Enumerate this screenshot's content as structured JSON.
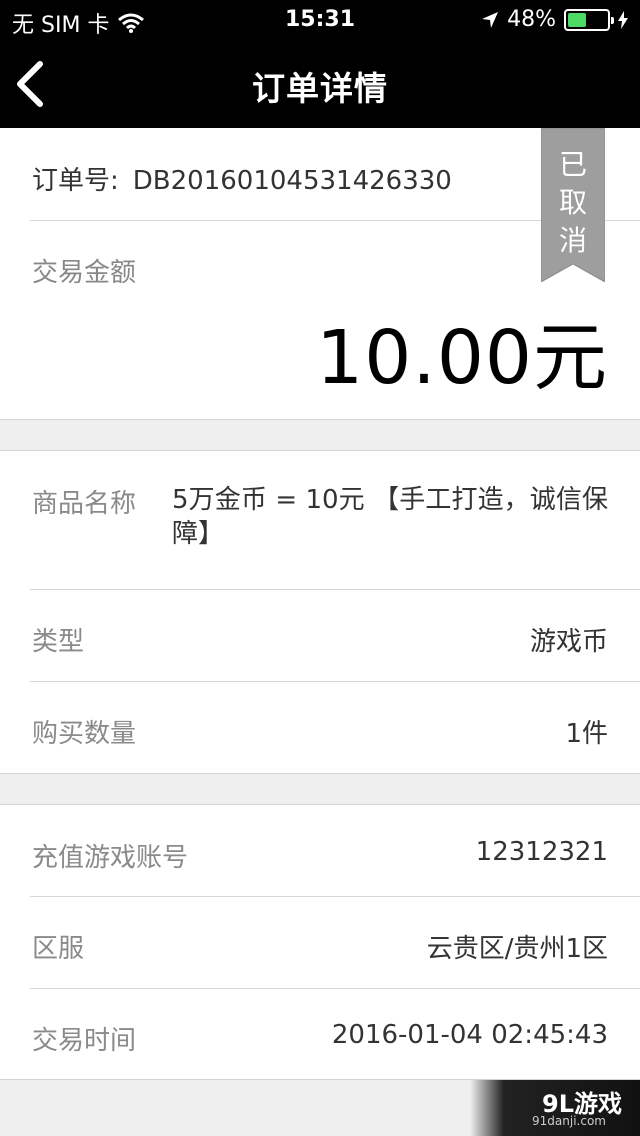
{
  "status_bar": {
    "carrier": "无 SIM 卡",
    "time": "15:31",
    "battery": "48%",
    "battery_level": 0.48
  },
  "nav": {
    "title": "订单详情"
  },
  "order": {
    "number_label": "订单号:",
    "number": "DB20160104531426330",
    "status": "已取消",
    "amount_label": "交易金额",
    "amount": "10.00元"
  },
  "goods": {
    "name_label": "商品名称",
    "name": "5万金币 = 10元 【手工打造，诚信保障】",
    "type_label": "类型",
    "type": "游戏币",
    "qty_label": "购买数量",
    "qty": "1件"
  },
  "account": {
    "account_label": "充值游戏账号",
    "account": "12312321",
    "server_label": "区服",
    "server": "云贵区/贵州1区",
    "time_label": "交易时间",
    "time": "2016-01-04 02:45:43"
  },
  "watermark": {
    "brand": "9L游戏",
    "domain": "91danji.com"
  },
  "colors": {
    "header": "#000000",
    "battery_fill": "#4cd964",
    "ribbon": "#9e9e9e"
  }
}
